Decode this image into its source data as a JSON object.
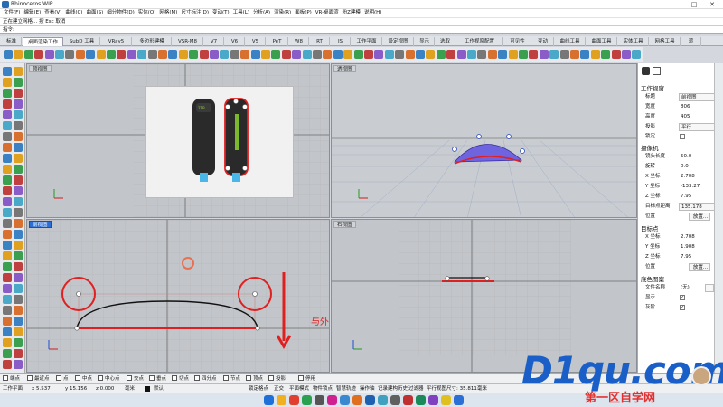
{
  "app": {
    "title": "Rhinoceros WIP"
  },
  "menu": [
    "文件(F)",
    "编辑(E)",
    "查看(V)",
    "曲线(C)",
    "曲面(S)",
    "细分物件(D)",
    "实体(O)",
    "网格(M)",
    "尺寸标注(D)",
    "变动(T)",
    "工具(L)",
    "分析(A)",
    "渲染(R)",
    "面板(P)",
    "VR-桌面渲",
    "粉Z建模",
    "说明(H)"
  ],
  "command": {
    "history": "正在建立网格... 按 Esc 取消",
    "prompt": "指令:"
  },
  "tabs": [
    "标准",
    "工作平面",
    "设定视图",
    "显示",
    "选取",
    "工作视窗配置",
    "可见性",
    "变动",
    "曲线工具",
    "曲面工具",
    "实体工具",
    "网格工具",
    "渲"
  ],
  "tabs_left": [
    "标准",
    "桌面渲染工作",
    "SubD 工具",
    "VRay5",
    "多边形建模",
    "VSR-M8",
    "V7",
    "V6",
    "V5",
    "PeT",
    "W8",
    "RT",
    "JS"
  ],
  "viewports": {
    "top": "顶视图",
    "perspective": "透视图",
    "front": "前视图",
    "right": "右视图"
  },
  "annotation": "与外排点垂直于X轴",
  "panel": {
    "section_viewport": "工作视窗",
    "title_label": "标题",
    "title_value": "前视图",
    "width_label": "宽度",
    "width_value": "806",
    "height_label": "高度",
    "height_value": "405",
    "projection_label": "投影",
    "projection_value": "平行",
    "lock_label": "锁定",
    "section_camera": "摄像机",
    "lens_label": "镜头长度",
    "lens_value": "50.0",
    "rotation_label": "旋转",
    "rotation_value": "0.0",
    "xpos_label": "X 坐标",
    "xpos_value": "2.708",
    "ypos_label": "Y 坐标",
    "ypos_value": "-133.27",
    "zpos_label": "Z 坐标",
    "zpos_value": "7.95",
    "dist_label": "目标点距离",
    "dist_value": "135.178",
    "location_label": "位置",
    "place_button": "放置...",
    "section_target": "目标点",
    "tx_label": "X 坐标",
    "tx_value": "2.708",
    "ty_label": "Y 坐标",
    "ty_value": "1.908",
    "tz_label": "Z 坐标",
    "tz_value": "7.95",
    "section_bg": "底色图案",
    "file_label": "文件名称",
    "file_value": "(无)",
    "browse": "...",
    "show_label": "显示",
    "gray_label": "灰阶"
  },
  "osnap": [
    "端点",
    "最近点",
    "点",
    "中点",
    "中心点",
    "交点",
    "垂点",
    "切点",
    "四分点",
    "节点",
    "顶点",
    "投影",
    "停用"
  ],
  "status": {
    "cplane": "工作平面",
    "x": "x 5.537",
    "y": "y 15.156",
    "z": "z 0.000",
    "unit": "毫米",
    "layer": "默认",
    "items": [
      "锁定格点",
      "正交",
      "平面模式",
      "物件锁点",
      "智慧轨迹",
      "操作轴",
      "记录建构历史",
      "过滤器",
      "平行视图尺寸: 35.811",
      "毫米"
    ]
  },
  "watermark": {
    "logo": "D1qu.com",
    "sub": "第一区自学网"
  },
  "colors": {
    "accent": "#2b6fd6",
    "curve_red": "#e02020",
    "grid_bg": "#c2c5c9"
  }
}
